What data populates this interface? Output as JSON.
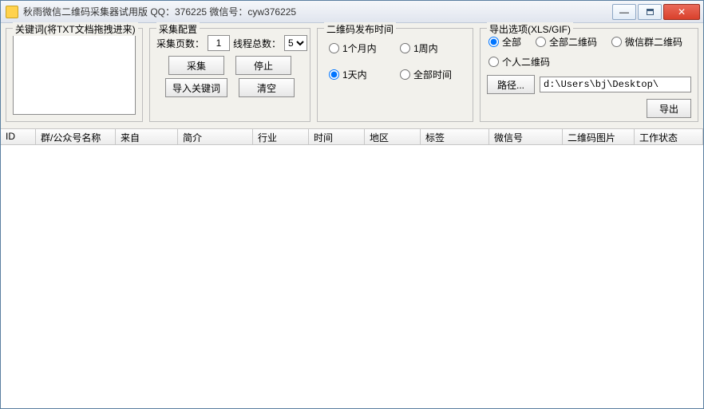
{
  "title": "秋雨微信二维码采集器试用版 QQ：376225   微信号：cyw376225",
  "keyword_group": {
    "legend": "关键词(将TXT文档拖拽进来)"
  },
  "config_group": {
    "legend": "采集配置",
    "pages_label": "采集页数：",
    "pages_value": "1",
    "threads_label": "线程总数：",
    "threads_value": "5",
    "btn_collect": "采集",
    "btn_stop": "停止",
    "btn_import": "导入关键词",
    "btn_clear": "清空"
  },
  "time_group": {
    "legend": "二维码发布时间",
    "opt_1month": "1个月内",
    "opt_1week": "1周内",
    "opt_1day": "1天内",
    "opt_all": "全部时间"
  },
  "export_group": {
    "legend": "导出选项(XLS/GIF)",
    "opt_all": "全部",
    "opt_all_qr": "全部二维码",
    "opt_group_qr": "微信群二维码",
    "opt_personal_qr": "个人二维码",
    "btn_path": "路径...",
    "path_value": "d:\\Users\\bj\\Desktop\\",
    "btn_export": "导出"
  },
  "columns": {
    "id": "ID",
    "name": "群/公众号名称",
    "from": "来自",
    "intro": "简介",
    "industry": "行业",
    "time": "时间",
    "region": "地区",
    "tag": "标签",
    "wechat": "微信号",
    "qr_img": "二维码图片",
    "status": "工作状态"
  }
}
